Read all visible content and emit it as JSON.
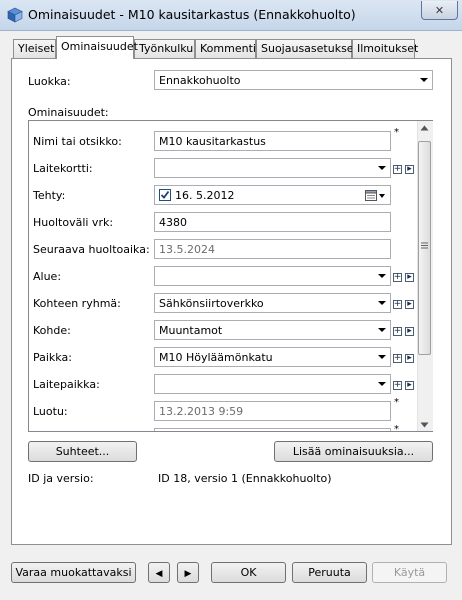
{
  "window": {
    "title": "Ominaisuudet - M10 kausitarkastus (Ennakkohuolto)",
    "close_glyph": "✕"
  },
  "tabs": [
    {
      "label": "Yleiset"
    },
    {
      "label": "Ominaisuudet"
    },
    {
      "label": "Työnkulku"
    },
    {
      "label": "Kommentit"
    },
    {
      "label": "Suojausasetukset"
    },
    {
      "label": "Ilmoitukset"
    }
  ],
  "active_tab": "Ominaisuudet",
  "luokka": {
    "label": "Luokka:",
    "value": "Ennakkohuolto"
  },
  "ominaisuudet_label": "Ominaisuudet:",
  "fields": {
    "nimi": {
      "label": "Nimi tai otsikko:",
      "value": "M10 kausitarkastus",
      "required_mark": "*"
    },
    "laitekortti": {
      "label": "Laitekortti:",
      "value": ""
    },
    "tehty": {
      "label": "Tehty:",
      "checked": true,
      "value": "16.  5.2012"
    },
    "huoltovali": {
      "label": "Huoltoväli vrk:",
      "value": "4380"
    },
    "seuraava": {
      "label": "Seuraava huoltoaika:",
      "value": "13.5.2024"
    },
    "alue": {
      "label": "Alue:",
      "value": ""
    },
    "kohteen_ryhma": {
      "label": "Kohteen ryhmä:",
      "value": "Sähkönsiirtoverkko"
    },
    "kohde": {
      "label": "Kohde:",
      "value": "Muuntamot"
    },
    "paikka": {
      "label": "Paikka:",
      "value": "M10 Höyläämönkatu"
    },
    "laitepaikka": {
      "label": "Laitepaikka:",
      "value": ""
    },
    "luotu": {
      "label": "Luotu:",
      "value": "13.2.2013 9:59",
      "required_mark": "*"
    },
    "partial": {
      "required_mark": "*"
    }
  },
  "buttons": {
    "suhteet": "Suhteet...",
    "lisaa": "Lisää ominaisuuksia...",
    "varaa": "Varaa muokattavaksi",
    "ok": "OK",
    "peruuta": "Peruuta",
    "kayta": "Käytä"
  },
  "id_version": {
    "label": "ID ja versio:",
    "value": "ID 18, versio 1 (Ennakkohuolto)"
  },
  "icons": {
    "add": "+",
    "more": "▸",
    "prev": "◀",
    "next": "▶"
  }
}
